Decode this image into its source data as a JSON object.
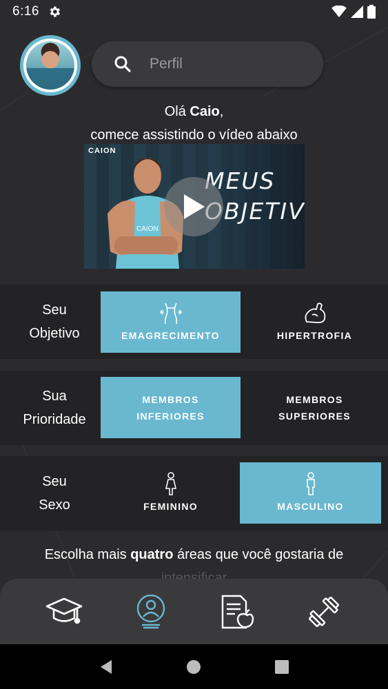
{
  "status_bar": {
    "time": "6:16"
  },
  "search": {
    "placeholder": "Perfil"
  },
  "greeting": {
    "hello": "Olá ",
    "name": "Caio",
    "comma": ",",
    "line2": "comece assistindo o vídeo abaixo"
  },
  "video": {
    "logo": "CAION",
    "title_line1": "MEUS",
    "title_line2": "OBJETIVOS"
  },
  "goal": {
    "label_line1": "Seu",
    "label_line2": "Objetivo",
    "options": [
      {
        "label": "EMAGRECIMENTO",
        "icon": "waist-icon",
        "selected": true
      },
      {
        "label": "HIPERTROFIA",
        "icon": "bicep-icon",
        "selected": false
      }
    ]
  },
  "priority": {
    "label_line1": "Sua",
    "label_line2": "Prioridade",
    "options": [
      {
        "line1": "MEMBROS",
        "line2": "INFERIORES",
        "selected": true
      },
      {
        "line1": "MEMBROS",
        "line2": "SUPERIORES",
        "selected": false
      }
    ]
  },
  "sex": {
    "label_line1": "Seu",
    "label_line2": "Sexo",
    "options": [
      {
        "label": "FEMININO",
        "icon": "female-icon",
        "selected": false
      },
      {
        "label": "MASCULINO",
        "icon": "male-icon",
        "selected": true
      }
    ]
  },
  "choose": {
    "before": "Escolha mais ",
    "bold": "quatro",
    "after": " áreas que você gostaria de",
    "line2": "intensificar"
  },
  "tabs": [
    {
      "icon": "graduation-cap-icon",
      "active": false
    },
    {
      "icon": "profile-icon",
      "active": true
    },
    {
      "icon": "diet-document-icon",
      "active": false
    },
    {
      "icon": "dumbbell-icon",
      "active": false
    }
  ],
  "colors": {
    "accent": "#69b8cf",
    "background": "#2b2b2d",
    "row_background": "#232325",
    "tabbar": "#3a3a3c"
  }
}
